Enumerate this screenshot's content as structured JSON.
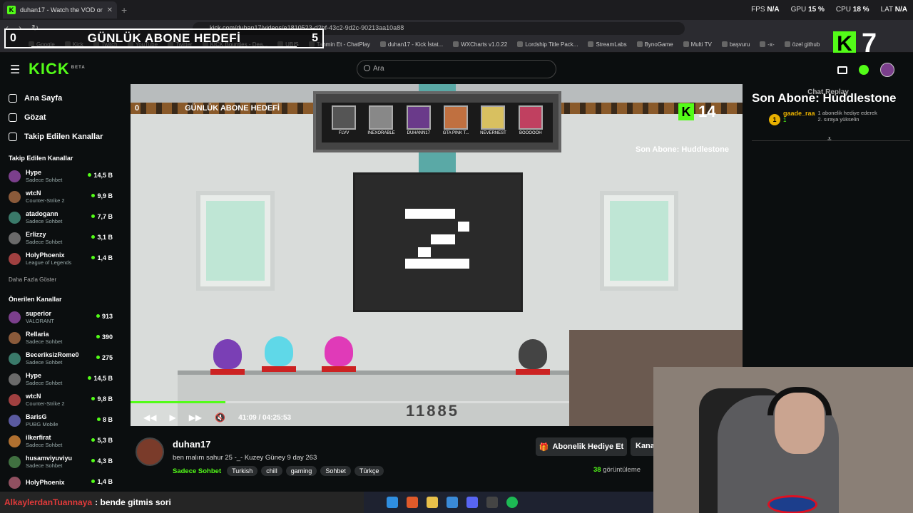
{
  "browser": {
    "tab_title": "duhan17 - Watch the VOD on Ki",
    "tab_icon": "kick-favicon",
    "address": "kick.com/duhan17/videos/e1810523-d2bf-43c2-9d2c-90213aa10a88",
    "stats": {
      "fps_label": "FPS",
      "fps": "N/A",
      "gpu_label": "GPU",
      "gpu": "15 %",
      "cpu_label": "CPU",
      "cpu": "18 %",
      "lat_label": "LAT",
      "lat": "N/A"
    },
    "bookmarks": [
      "Google",
      "Kick",
      "Twitch",
      "YouTube",
      "Twitter",
      "KICK Bounties - Dea...",
      "UBIS",
      "Tahmin Et - ChatPlay",
      "duhan17 - Kick İstat...",
      "WXCharts v1.0.22",
      "Lordship Title Pack...",
      "StreamLabs",
      "BynoGame",
      "Multi TV",
      "başvuru",
      "-x-",
      "özel github"
    ]
  },
  "overlay": {
    "goal_left": "0",
    "goal_title": "GÜNLÜK ABONE HEDEFİ",
    "goal_right": "5",
    "kick_count": "7"
  },
  "header": {
    "logo": "KICK",
    "logo_sup": "BETA",
    "search_placeholder": "Ara"
  },
  "sidebar": {
    "nav": [
      {
        "label": "Ana Sayfa",
        "icon": "home-icon"
      },
      {
        "label": "Gözat",
        "icon": "browse-icon"
      },
      {
        "label": "Takip Edilen Kanallar",
        "icon": "heart-icon"
      }
    ],
    "followed_heading": "Takip Edilen Kanallar",
    "followed": [
      {
        "name": "Hype",
        "category": "Sadece Sohbet",
        "viewers": "14,5 B"
      },
      {
        "name": "wtcN",
        "category": "Counter-Strike 2",
        "viewers": "9,9 B"
      },
      {
        "name": "atadogann",
        "category": "Sadece Sohbet",
        "viewers": "7,7 B"
      },
      {
        "name": "Erlizzy",
        "category": "Sadece Sohbet",
        "viewers": "3,1 B"
      },
      {
        "name": "HolyPhoenix",
        "category": "League of Legends",
        "viewers": "1,4 B"
      }
    ],
    "show_more": "Daha Fazla Göster",
    "recommended_heading": "Önerilen Kanallar",
    "recommended": [
      {
        "name": "superior",
        "category": "VALORANT",
        "viewers": "913"
      },
      {
        "name": "Rellaria",
        "category": "Sadece Sohbet",
        "viewers": "390"
      },
      {
        "name": "BeceriksizRome0",
        "category": "Sadece Sohbet",
        "viewers": "275"
      },
      {
        "name": "Hype",
        "category": "Sadece Sohbet",
        "viewers": "14,5 B"
      },
      {
        "name": "wtcN",
        "category": "Counter-Strike 2",
        "viewers": "9,8 B"
      },
      {
        "name": "BarisG",
        "category": "PUBG Mobile",
        "viewers": "8 B"
      },
      {
        "name": "ilkerfirat",
        "category": "Sadece Sohbet",
        "viewers": "5,3 B"
      },
      {
        "name": "husamviyuviyu",
        "category": "Sadece Sohbet",
        "viewers": "4,3 B"
      },
      {
        "name": "HolyPhoenix",
        "category": "",
        "viewers": "1,4 B"
      }
    ]
  },
  "video": {
    "ingame_goal_left": "0",
    "ingame_goal_title": "GÜNLÜK ABONE HEDEFİ",
    "ingame_goal_right": "5",
    "ingame_kick_count": "14",
    "ingame_last_sub": "Son Abone: Huddlestone",
    "cards": [
      "FLVV",
      "INEXORABLE",
      "DUHANN17",
      "GTA PINK T...",
      "NEVERNEST",
      "BOOOOOH"
    ],
    "score": "11885",
    "current_time": "41:09",
    "separator": "/",
    "duration": "04:25:53",
    "progress_fraction": 0.155
  },
  "chat": {
    "header": "Chat Replay",
    "last_sub": "Son Abone: Huddlestone",
    "gift_badge": "1",
    "gift_user": "gaade_raa",
    "gift_count": "1",
    "gift_message": "1 abonelik hediye ederek 2. sıraya yükselin"
  },
  "stream": {
    "channel": "duhan17",
    "title": "ben malım sahur 25 -_- Kuzey Güney 9 day 263",
    "category": "Sadece Sohbet",
    "tags": [
      "Turkish",
      "chill",
      "gaming",
      "Sohbet",
      "Türkçe"
    ],
    "gift_button": "Abonelik Hediye Et",
    "second_button": "Kana",
    "views_count": "38",
    "views_label": "görüntüleme"
  },
  "alert": {
    "user": "AlkaylerdanTuannaya",
    "message": ": bende gitmis sori"
  },
  "colors": {
    "accent": "#53fc18",
    "bg": "#0b0e0f"
  }
}
